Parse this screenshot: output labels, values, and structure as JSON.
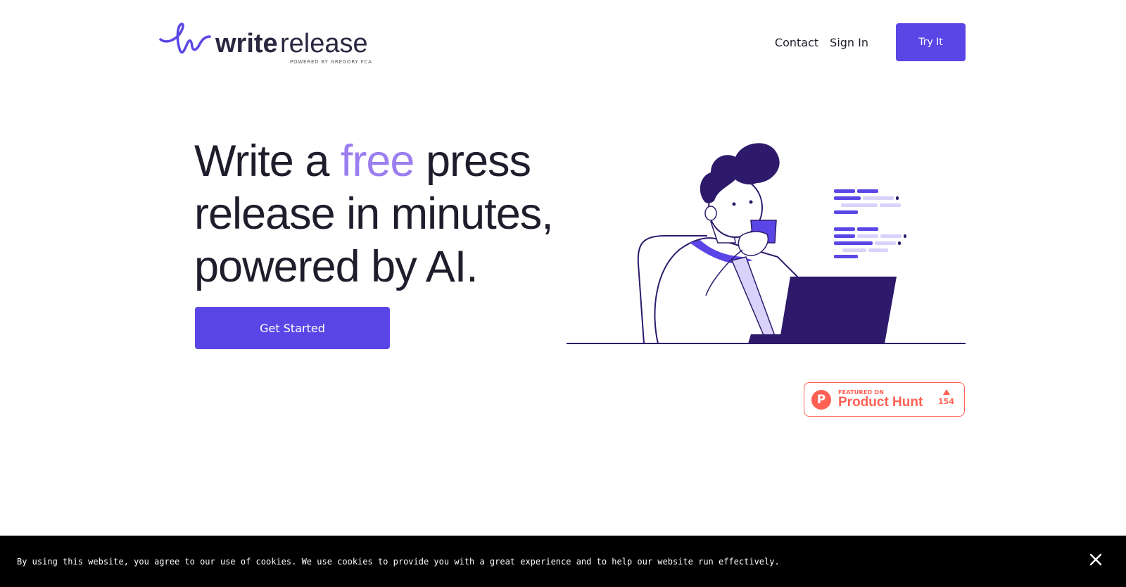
{
  "header": {
    "logo": {
      "brand_write": "write",
      "brand_release": "release",
      "tagline": "POWERED BY GREGORY FCA"
    },
    "nav": {
      "contact_label": "Contact",
      "signin_label": "Sign In",
      "try_label": "Try It"
    }
  },
  "hero": {
    "title_part1": "Write a ",
    "title_accent": "free",
    "title_part2": " press release in minutes, powered by AI.",
    "cta_label": "Get Started"
  },
  "product_hunt": {
    "featured_label": "FEATURED ON",
    "name": "Product Hunt",
    "votes": "154",
    "logo_letter": "P"
  },
  "cookie_bar": {
    "text": "By using this website, you agree to our use of cookies. We use cookies to provide you with a great experience and to help our website run effectively."
  },
  "colors": {
    "brand": "#5a46e6",
    "accent": "#9b7ef0",
    "dark": "#2e1a6b",
    "product_hunt": "#ff6154"
  },
  "icons": {
    "close": "close-icon",
    "illustration": "person-with-laptop-illustration"
  }
}
